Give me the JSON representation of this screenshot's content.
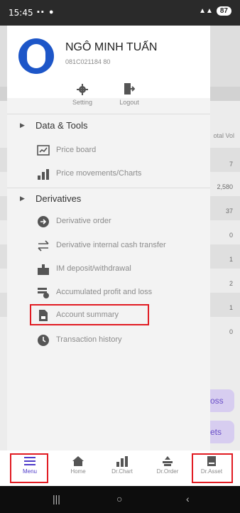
{
  "status": {
    "time": "15:45",
    "battery": "87"
  },
  "user": {
    "name": "NGÔ MINH TUẤN",
    "account_id": "081C021184 80"
  },
  "quick_actions": {
    "setting_label": "Setting",
    "logout_label": "Logout"
  },
  "sections": {
    "data_tools": {
      "label": "Data & Tools",
      "items": [
        {
          "label": "Price board",
          "icon": "chart-board-icon"
        },
        {
          "label": "Price movements/Charts",
          "icon": "bar-chart-icon"
        }
      ]
    },
    "derivatives": {
      "label": "Derivatives",
      "items": [
        {
          "label": "Derivative order",
          "icon": "arrow-circle-icon"
        },
        {
          "label": "Derivative internal cash transfer",
          "icon": "transfer-arrows-icon"
        },
        {
          "label": "IM deposit/withdrawal",
          "icon": "deposit-icon"
        },
        {
          "label": "Accumulated profit and loss",
          "icon": "profit-loss-icon"
        },
        {
          "label": "Account summary",
          "icon": "document-icon"
        },
        {
          "label": "Transaction history",
          "icon": "clock-icon"
        }
      ]
    }
  },
  "background": {
    "column_header": "otal Vol",
    "values": [
      "7",
      "2,580",
      "37",
      "0",
      "1",
      "2",
      "1",
      "0"
    ],
    "pill_1": "oss",
    "pill_2": "ets"
  },
  "bottom_nav": [
    {
      "label": "Menu",
      "icon": "hamburger-icon",
      "active": true
    },
    {
      "label": "Home",
      "icon": "home-icon",
      "active": false
    },
    {
      "label": "Dr.Chart",
      "icon": "chart-icon",
      "active": false
    },
    {
      "label": "Dr.Order",
      "icon": "order-icon",
      "active": false
    },
    {
      "label": "Dr.Asset",
      "icon": "asset-icon",
      "active": false
    }
  ],
  "colors": {
    "accent": "#4e3bc9",
    "highlight": "#e11b22",
    "avatar": "#1d56c8"
  }
}
